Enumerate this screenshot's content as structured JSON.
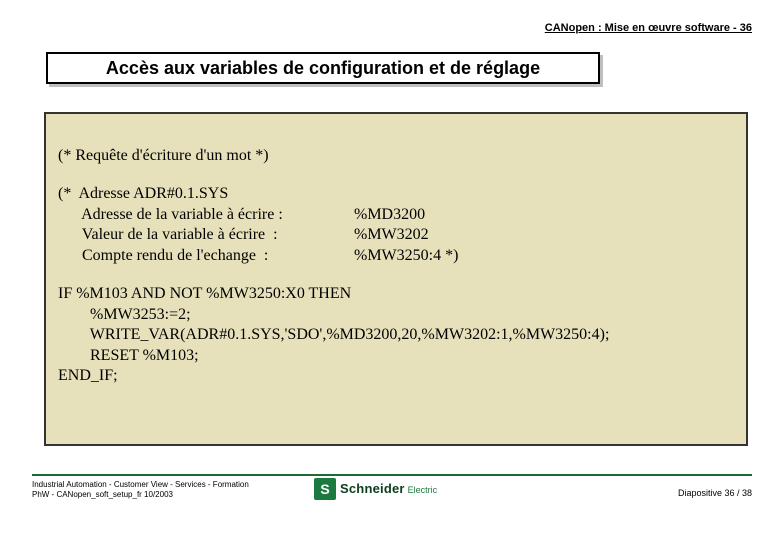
{
  "header": "CANopen : Mise en œuvre software - 36",
  "title": "Accès aux variables de configuration et de réglage",
  "code": {
    "l1": "(* Requête d'écriture d'un mot *)",
    "b2": {
      "r1a": "(*  Adresse ADR#0.1.SYS",
      "r2a": "      Adresse de la variable à écrire :",
      "r2b": "%MD3200",
      "r3a": "      Valeur de la variable à écrire  :",
      "r3b": "%MW3202",
      "r4a": "      Compte rendu de l'echange  :",
      "r4b": "%MW3250:4 *)"
    },
    "b3": {
      "r1": "IF %M103 AND NOT %MW3250:X0 THEN",
      "r2": "        %MW3253:=2;",
      "r3": "        WRITE_VAR(ADR#0.1.SYS,'SDO',%MD3200,20,%MW3202:1,%MW3250:4);",
      "r4": "        RESET %M103;",
      "r5": "END_IF;"
    }
  },
  "footer": {
    "left1": "Industrial Automation - Customer View - Services - Formation",
    "left2": "PhW - CANopen_soft_setup_fr 10/2003",
    "right": "Diapositive 36 / 38",
    "logo1": "Schneider",
    "logo2": "Electric"
  }
}
